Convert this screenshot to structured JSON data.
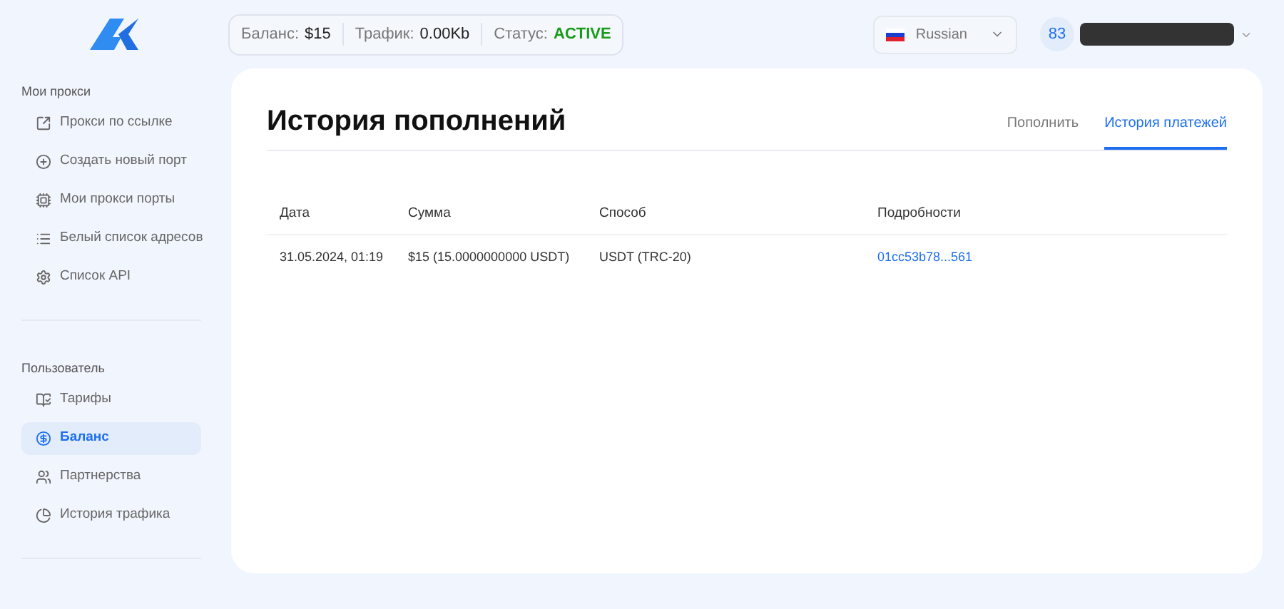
{
  "header": {
    "stats": [
      {
        "label": "Баланс:",
        "value": "$15",
        "kind": "plain"
      },
      {
        "label": "Трафик:",
        "value": "0.00Kb",
        "kind": "plain"
      },
      {
        "label": "Статус:",
        "value": "ACTIVE",
        "kind": "status"
      }
    ],
    "language": "Russian",
    "user_badge": "83"
  },
  "sidebar": {
    "sections": [
      {
        "title": "Мои прокси",
        "items": [
          {
            "label": "Прокси по ссылке",
            "selected": false
          },
          {
            "label": "Создать новый порт",
            "selected": false
          },
          {
            "label": "Мои прокси порты",
            "selected": false
          },
          {
            "label": "Белый список адресов",
            "selected": false
          },
          {
            "label": "Список API",
            "selected": false
          }
        ]
      },
      {
        "title": "Пользователь",
        "items": [
          {
            "label": "Тарифы",
            "selected": false
          },
          {
            "label": "Баланс",
            "selected": true
          },
          {
            "label": "Партнерства",
            "selected": false
          },
          {
            "label": "История трафика",
            "selected": false
          }
        ]
      }
    ]
  },
  "page": {
    "title": "История пополнений",
    "tabs": [
      {
        "label": "Пополнить",
        "selected": false
      },
      {
        "label": "История платежей",
        "selected": true
      }
    ],
    "table": {
      "columns": [
        "Дата",
        "Сумма",
        "Способ",
        "Подробности"
      ],
      "rows": [
        [
          "31.05.2024, 01:19",
          "$15 (15.0000000000 USDT)",
          "USDT (TRC-20)",
          "01cc53b78...561"
        ]
      ]
    }
  }
}
